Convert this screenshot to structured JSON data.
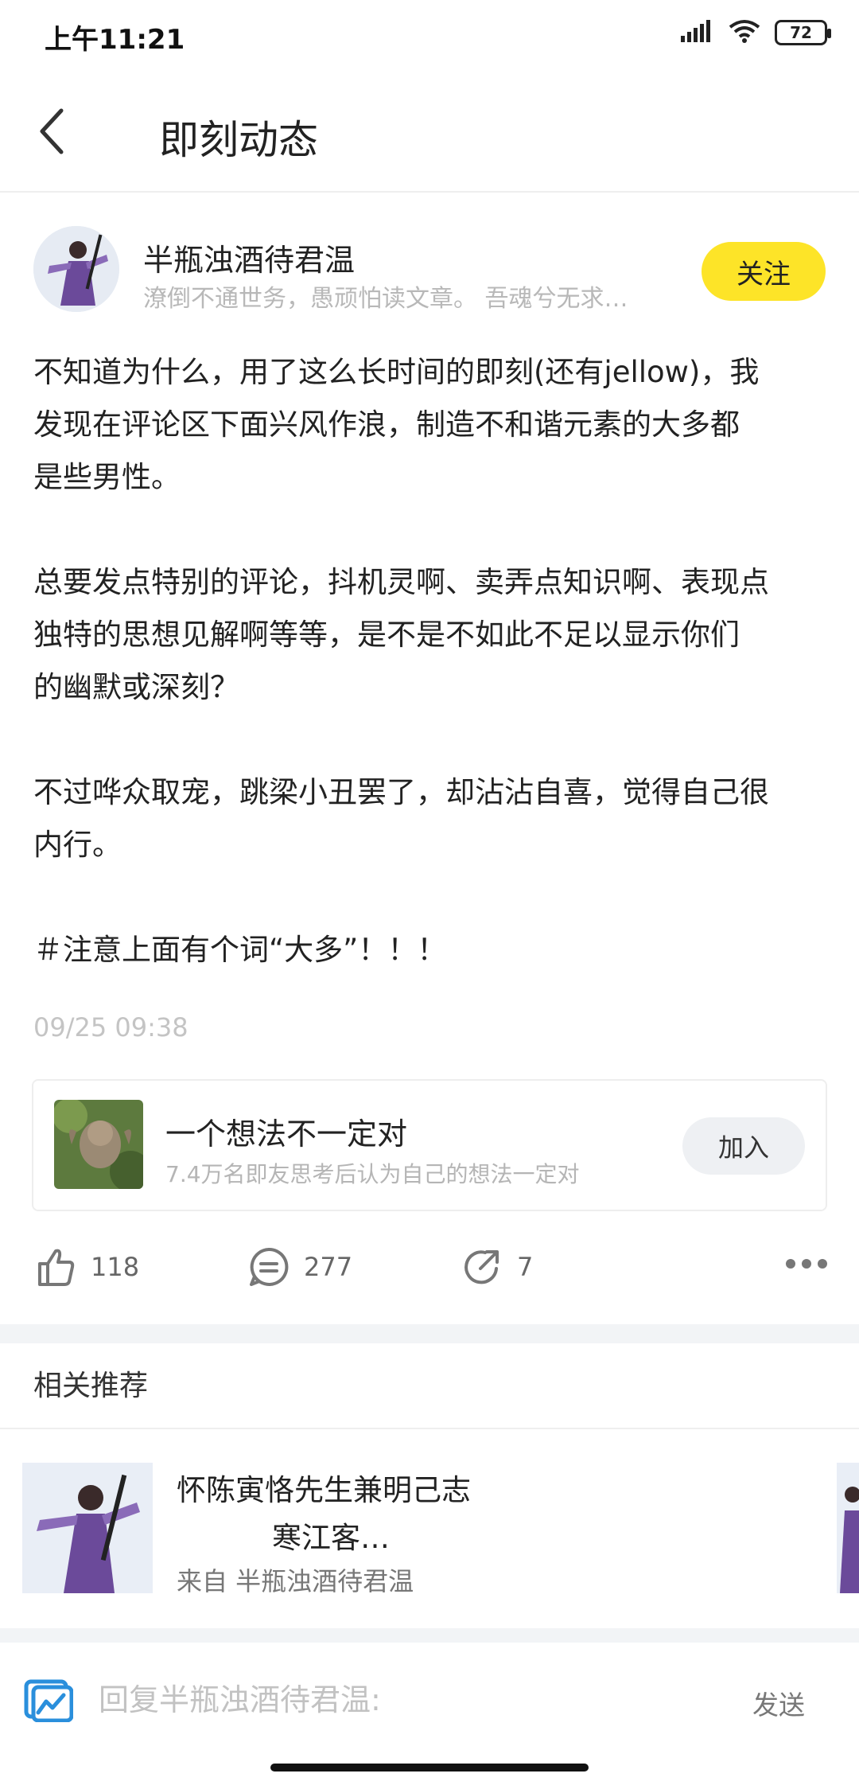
{
  "status_bar": {
    "time": "上午11:21",
    "battery": "72"
  },
  "header": {
    "title": "即刻动态",
    "back_icon": "chevron-left-icon"
  },
  "author": {
    "name": "半瓶浊酒待君温",
    "bio": "潦倒不通世务，愚顽怕读文章。 吾魂兮无求…",
    "follow_label": "关注"
  },
  "post": {
    "paragraphs": [
      [
        "不知道为什么，用了这么长时间的即刻(还有jellow)，我",
        "发现在评论区下面兴风作浪，制造不和谐元素的大多都",
        "是些男性。"
      ],
      [
        "总要发点特别的评论，抖机灵啊、卖弄点知识啊、表现点",
        "独特的思想见解啊等等，是不是不如此不足以显示你们",
        "的幽默或深刻？"
      ],
      [
        "不过哗众取宠，跳梁小丑罢了，却沾沾自喜，觉得自己很",
        "内行。"
      ],
      [
        "＃注意上面有个词“大多”！！！"
      ]
    ],
    "time": "09/25 09:38"
  },
  "topic": {
    "title": "一个想法不一定对",
    "subtitle": "7.4万名即友思考后认为自己的想法一定对",
    "join_label": "加入"
  },
  "actions": {
    "likes": "118",
    "comments": "277",
    "shares": "7"
  },
  "related": {
    "section_title": "相关推荐",
    "items": [
      {
        "title": "怀陈寅恪先生兼明己志",
        "subtitle": "寒江客…",
        "from": "来自 半瓶浊酒待君温"
      }
    ]
  },
  "reply": {
    "placeholder": "回复半瓶浊酒待君温:",
    "send_label": "发送"
  },
  "colors": {
    "accent": "#fde428",
    "reply_icon": "#2a8fdc"
  }
}
